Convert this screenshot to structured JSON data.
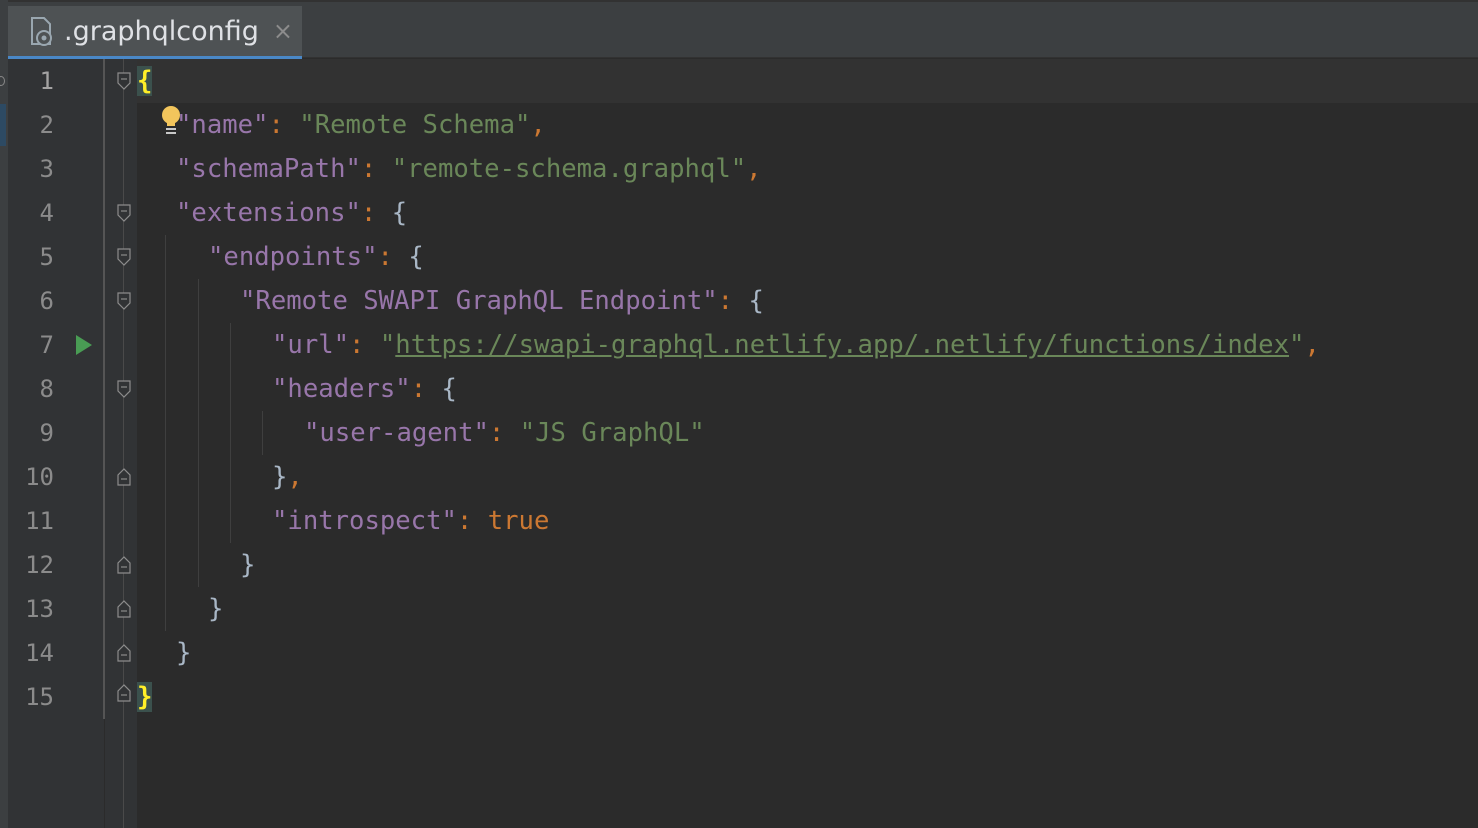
{
  "tab": {
    "title": ".graphqlconfig",
    "close_symbol": "×",
    "icon": "graphql-config-file-icon"
  },
  "editor": {
    "line_numbers": [
      "1",
      "2",
      "3",
      "4",
      "5",
      "6",
      "7",
      "8",
      "9",
      "10",
      "11",
      "12",
      "13",
      "14",
      "15"
    ],
    "lines": {
      "l1_brace": "{",
      "l2_key": "\"name\"",
      "l2_colon": ": ",
      "l2_val": "\"Remote Schema\"",
      "l2_comma": ",",
      "l3_key": "\"schemaPath\"",
      "l3_colon": ": ",
      "l3_val": "\"remote-schema.graphql\"",
      "l3_comma": ",",
      "l4_key": "\"extensions\"",
      "l4_colon": ": ",
      "l4_brace": "{",
      "l5_key": "\"endpoints\"",
      "l5_colon": ": ",
      "l5_brace": "{",
      "l6_key": "\"Remote SWAPI GraphQL Endpoint\"",
      "l6_colon": ": ",
      "l6_brace": "{",
      "l7_key": "\"url\"",
      "l7_colon": ": ",
      "l7_q1": "\"",
      "l7_url": "https://swapi-graphql.netlify.app/.netlify/functions/index",
      "l7_q2": "\"",
      "l7_comma": ",",
      "l8_key": "\"headers\"",
      "l8_colon": ": ",
      "l8_brace": "{",
      "l9_key": "\"user-agent\"",
      "l9_colon": ": ",
      "l9_val": "\"JS GraphQL\"",
      "l10_brace": "}",
      "l10_comma": ",",
      "l11_key": "\"introspect\"",
      "l11_colon": ": ",
      "l11_val": "true",
      "l12_brace": "}",
      "l13_brace": "}",
      "l14_brace": "}",
      "l15_brace": "}"
    },
    "gutter_icons": {
      "intention": "lightbulb-icon",
      "run": "run-arrow-icon",
      "fold": "fold-marker-icon"
    }
  },
  "colors": {
    "background": "#2b2b2b",
    "key": "#9876aa",
    "string": "#6a8759",
    "punctuation": "#cc7832",
    "brace_highlight": "#ffef28",
    "tab_underline": "#4a88c7"
  }
}
